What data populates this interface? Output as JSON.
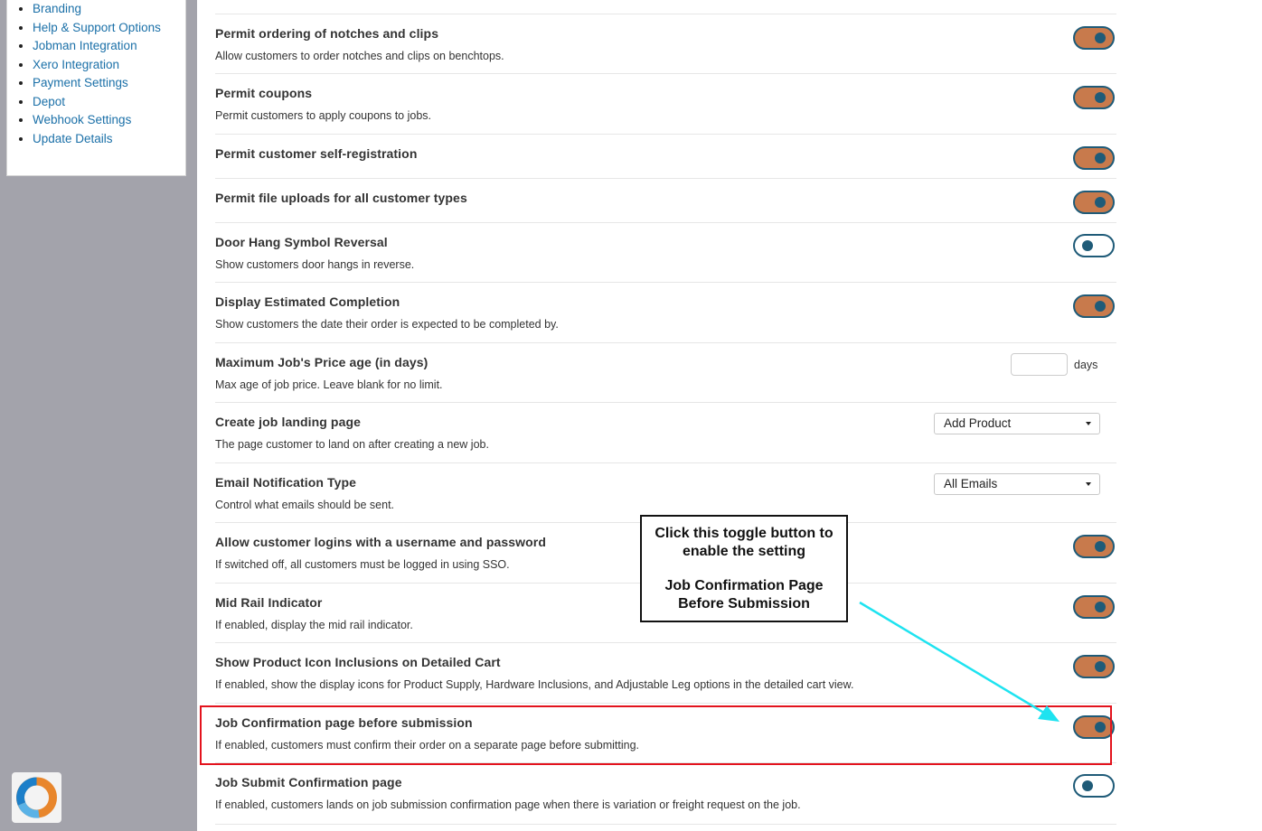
{
  "sidebar": {
    "items": [
      {
        "label": "Branding"
      },
      {
        "label": "Help & Support Options"
      },
      {
        "label": "Jobman Integration"
      },
      {
        "label": "Xero Integration"
      },
      {
        "label": "Payment Settings"
      },
      {
        "label": "Depot"
      },
      {
        "label": "Webhook Settings"
      },
      {
        "label": "Update Details"
      }
    ]
  },
  "settings": [
    {
      "title": "Permit ordering of notches and clips",
      "desc": "Allow customers to order notches and clips on benchtops.",
      "state": "on"
    },
    {
      "title": "Permit coupons",
      "desc": "Permit customers to apply coupons to jobs.",
      "state": "on"
    },
    {
      "title": "Permit customer self-registration",
      "desc": "",
      "state": "on"
    },
    {
      "title": "Permit file uploads for all customer types",
      "desc": "",
      "state": "on"
    },
    {
      "title": "Door Hang Symbol Reversal",
      "desc": "Show customers door hangs in reverse.",
      "state": "off"
    },
    {
      "title": "Display Estimated Completion",
      "desc": "Show customers the date their order is expected to be completed by.",
      "state": "on"
    },
    {
      "title": "Maximum Job's Price age (in days)",
      "desc": "Max age of job price. Leave blank for no limit.",
      "input_value": "",
      "unit": "days"
    },
    {
      "title": "Create job landing page",
      "desc": "The page customer to land on after creating a new job.",
      "select_value": "Add Product"
    },
    {
      "title": "Email Notification Type",
      "desc": "Control what emails should be sent.",
      "select_value": "All Emails"
    },
    {
      "title": "Allow customer logins with a username and password",
      "desc": "If switched off, all customers must be logged in using SSO.",
      "state": "on"
    },
    {
      "title": "Mid Rail Indicator",
      "desc": "If enabled, display the mid rail indicator.",
      "state": "on"
    },
    {
      "title": "Show Product Icon Inclusions on Detailed Cart",
      "desc": "If enabled, show the display icons for Product Supply, Hardware Inclusions, and Adjustable Leg options in the detailed cart view.",
      "state": "on"
    },
    {
      "title": "Job Confirmation page before submission",
      "desc": "If enabled, customers must confirm their order on a separate page before submitting.",
      "state": "on"
    },
    {
      "title": "Job Submit Confirmation page",
      "desc": "If enabled, customers lands on job submission confirmation page when there is variation or freight request on the job.",
      "state": "off"
    }
  ],
  "callout": {
    "line1": "Click this toggle button to",
    "line2": "enable the setting",
    "line3": "Job Confirmation Page",
    "line4": "Before Submission"
  },
  "colors": {
    "toggle_on": "#c87a4c",
    "toggle_border": "#1f5b78",
    "highlight": "#e3131d",
    "arrow": "#1ee3f0",
    "link": "#1b70a8"
  }
}
